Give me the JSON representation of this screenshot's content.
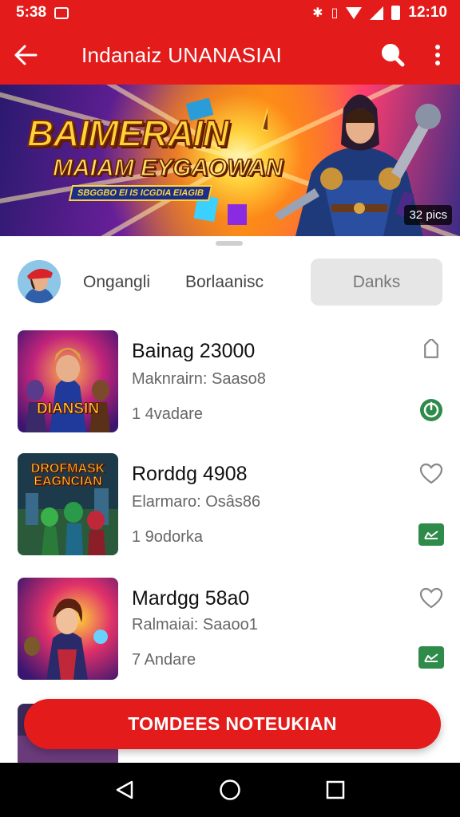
{
  "status_bar": {
    "time": "5:38",
    "clock_right": "12:10",
    "icons": [
      "image-icon",
      "bluetooth-icon",
      "vibrate-icon",
      "wifi-icon",
      "signal-icon",
      "battery-icon"
    ]
  },
  "app_bar": {
    "title": "Indanaiz UNANASIAI",
    "icons": [
      "back-arrow-icon",
      "search-icon",
      "more-vert-icon"
    ]
  },
  "banner": {
    "title_line1": "BAIMERAIN",
    "title_line2": "MAIAM EYGAOWAN",
    "ribbon": "SBGGBO EI IS ICGDIA EIAGIB",
    "badge": "32 pics"
  },
  "tabs": {
    "items": [
      {
        "label": "Ongangli"
      },
      {
        "label": "Borlaanisc"
      },
      {
        "label": "Danks",
        "selected": true
      }
    ]
  },
  "list": {
    "items": [
      {
        "title": "Bainag 23000",
        "subtitle": "Maknrairn: Saaso8",
        "meta": "1 4vadare",
        "thumb_caption": "DIANSIN",
        "favorite_icon": "tag-icon",
        "status_icon": "power-icon",
        "status_color": "#2e8b4a"
      },
      {
        "title": "Rorddg 4908",
        "subtitle": "Elarmaro: Osâs86",
        "meta": "1 9odorka",
        "thumb_caption": "DROFMASK EAGNCIAN",
        "favorite_icon": "heart-icon",
        "status_icon": "chart-icon",
        "status_color": "#2e8b4a"
      },
      {
        "title": "Mardgg 58a0",
        "subtitle": "Ralmaiai: Saaoo1",
        "meta": "7 Andare",
        "thumb_caption": "",
        "favorite_icon": "heart-icon",
        "status_icon": "chart-icon",
        "status_color": "#2e8b4a"
      }
    ]
  },
  "cta": {
    "label": "TOMDEES NOTEUKIAN"
  },
  "nav_bar": {
    "icons": [
      "back-triangle-icon",
      "home-circle-icon",
      "recents-square-icon"
    ]
  },
  "colors": {
    "primary": "#e31b1b",
    "accent_green": "#2e8b4a",
    "tab_selected_bg": "#e6e6e6"
  }
}
